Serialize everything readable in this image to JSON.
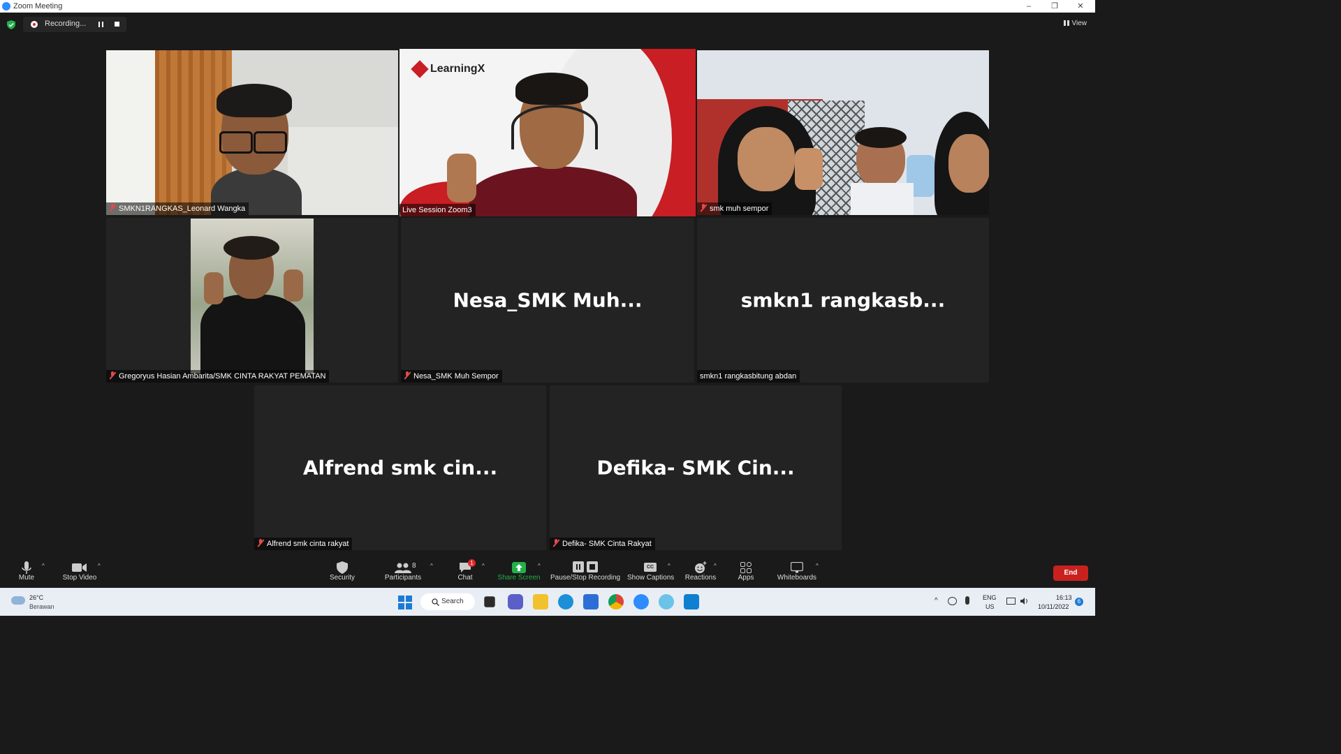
{
  "window": {
    "title": "Zoom Meeting",
    "minimize": "–",
    "restore": "❐",
    "close": "✕"
  },
  "topbar": {
    "recording_label": "Recording...",
    "view_label": "View"
  },
  "tiles": {
    "t1": {
      "name": "SMKN1RANGKAS_Leonard Wangka",
      "muted": true
    },
    "t2": {
      "name": "Live Session Zoom3",
      "muted": false,
      "brand": "LearningX"
    },
    "t3": {
      "name": "smk muh sempor",
      "muted": true
    },
    "t4": {
      "name": "Gregoryus Hasian Ambarita/SMK CINTA RAKYAT PEMATAN",
      "muted": true
    },
    "t5": {
      "name": "Nesa_SMK Muh Sempor",
      "display": "Nesa_SMK  Muh...",
      "muted": true
    },
    "t6": {
      "name": "smkn1 rangkasbitung abdan",
      "display": "smkn1  rangkasb...",
      "muted": false
    },
    "t7": {
      "name": "Alfrend smk cinta rakyat",
      "display": "Alfrend smk cin...",
      "muted": true
    },
    "t8": {
      "name": "Defika- SMK Cinta Rakyat",
      "display": "Defika-  SMK  Cin...",
      "muted": true
    }
  },
  "toolbar": {
    "mute": "Mute",
    "stop_video": "Stop Video",
    "security": "Security",
    "participants": "Participants",
    "participants_count": "8",
    "chat": "Chat",
    "chat_badge": "1",
    "share_screen": "Share Screen",
    "pause_stop_recording": "Pause/Stop Recording",
    "show_captions": "Show Captions",
    "cc": "CC",
    "reactions": "Reactions",
    "apps": "Apps",
    "whiteboards": "Whiteboards",
    "end": "End",
    "caret": "^"
  },
  "taskbar": {
    "weather_temp": "26°C",
    "weather_desc": "Berawan",
    "search": "Search",
    "lang_top": "ENG",
    "lang_bottom": "US",
    "time": "16:13",
    "date": "10/11/2022",
    "notif_count": "6",
    "tray_caret": "^"
  },
  "colors": {
    "accent_green": "#23b04a",
    "active_border": "#e9e76a",
    "end_red": "#c9221e",
    "muted_red": "#e34a4a"
  }
}
